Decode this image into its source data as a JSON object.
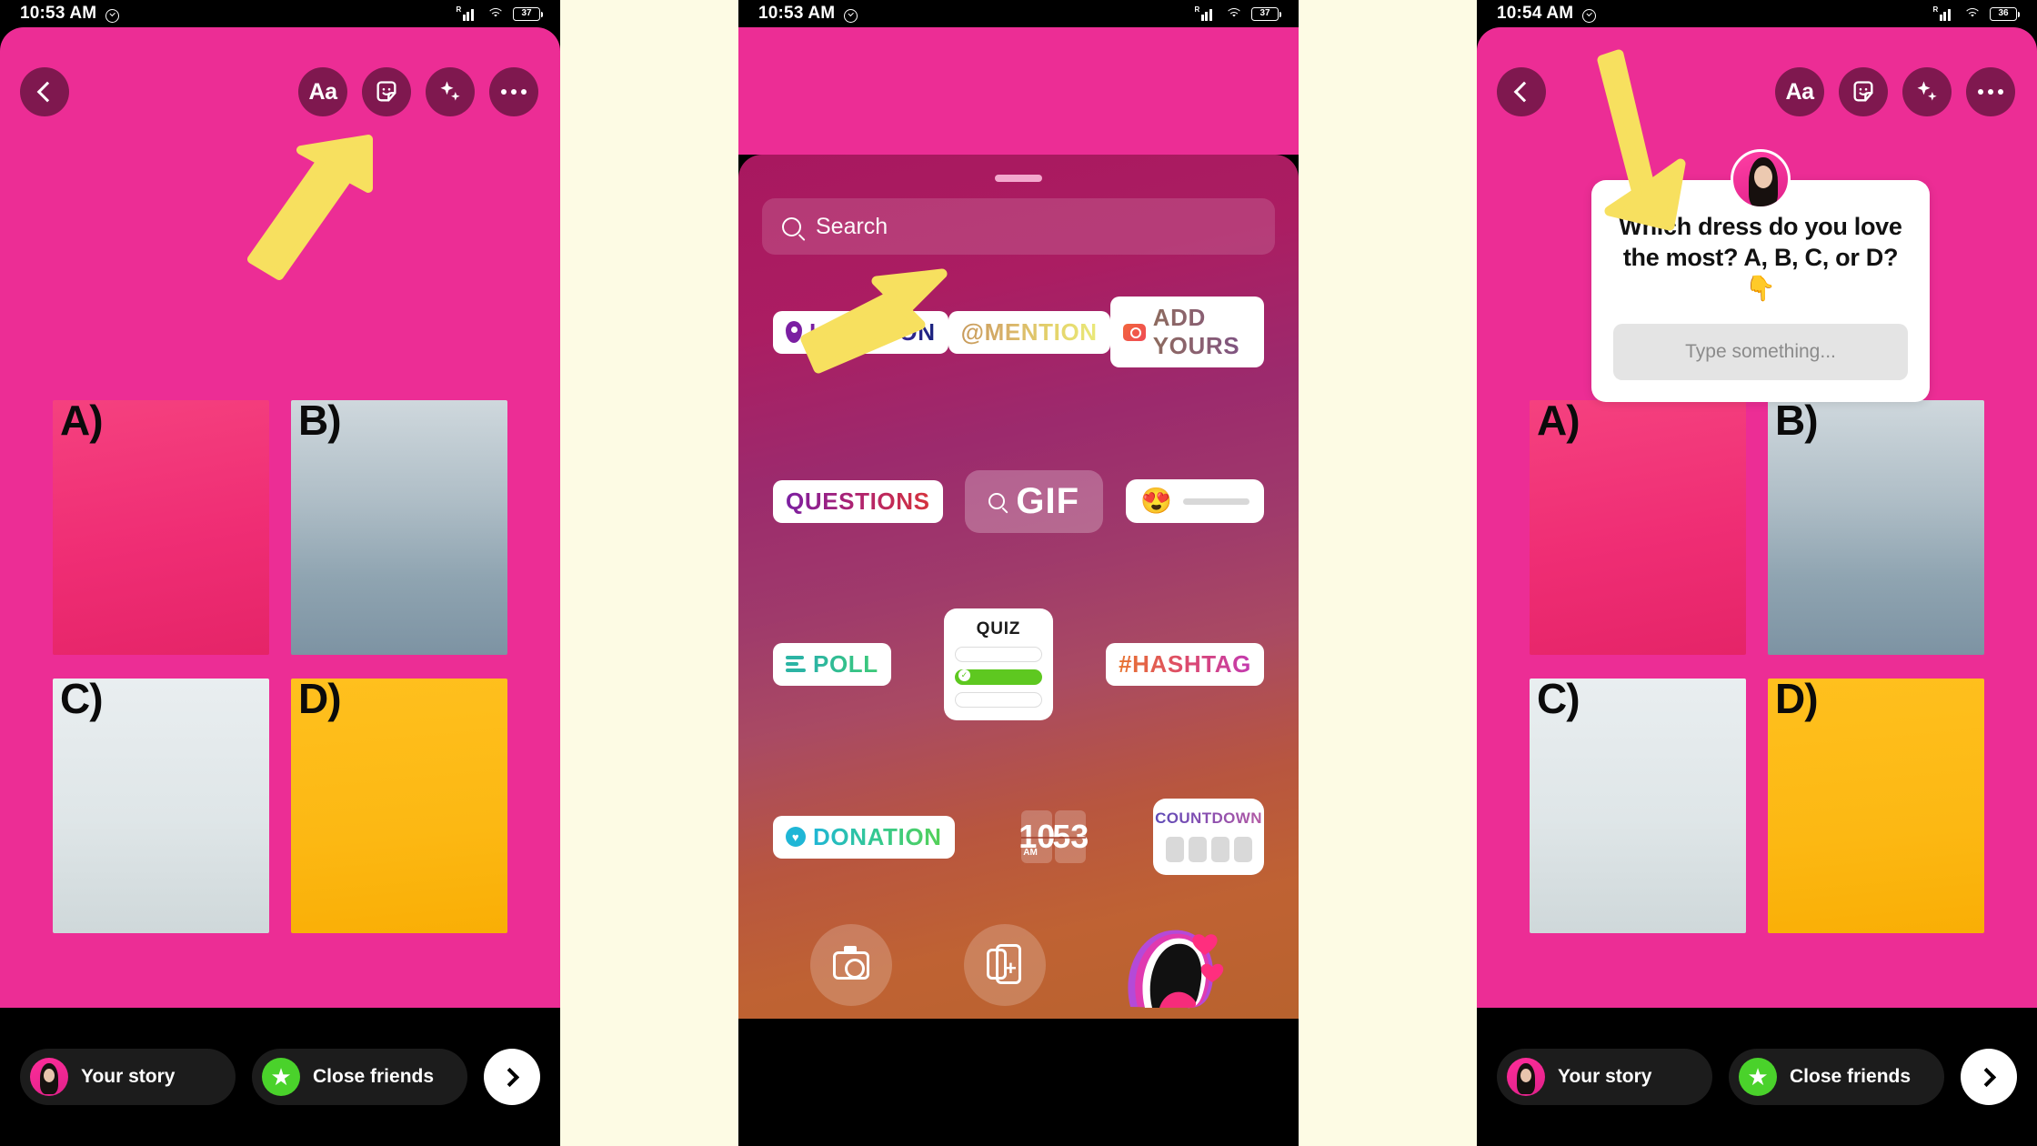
{
  "panels": [
    {
      "id": "panel-1",
      "status": {
        "time": "10:53 AM",
        "alarm_icon": "alarm-icon",
        "signal_icon": "signal-bars-icon",
        "roaming": "R",
        "wifi_icon": "wifi-icon",
        "battery": "37"
      },
      "toolbar": {
        "back": "back-icon",
        "text_tool": "Aa",
        "sticker_tool": "sticker-smiley-icon",
        "effects_tool": "sparkles-icon",
        "more_tool": "more-dots-icon"
      },
      "grid": [
        {
          "label": "A)",
          "name": "photo-option-a"
        },
        {
          "label": "B)",
          "name": "photo-option-b"
        },
        {
          "label": "C)",
          "name": "photo-option-c"
        },
        {
          "label": "D)",
          "name": "photo-option-d"
        }
      ],
      "share": {
        "your_story": "Your story",
        "close_friends": "Close friends",
        "next": "next-arrow-icon"
      },
      "annotation": "arrow pointing to sticker tool"
    },
    {
      "id": "panel-2",
      "status": {
        "time": "10:53 AM",
        "alarm_icon": "alarm-icon",
        "signal_icon": "signal-bars-icon",
        "roaming": "R",
        "wifi_icon": "wifi-icon",
        "battery": "37"
      },
      "tray": {
        "search_placeholder": "Search",
        "rows": [
          [
            {
              "label": "LOCATION",
              "icon": "location-pin-icon",
              "gradient": "g-location"
            },
            {
              "label": "@MENTION",
              "icon": "",
              "gradient": "g-mention"
            },
            {
              "label": "ADD YOURS",
              "icon": "camera-icon",
              "gradient": "g-addyours"
            }
          ],
          [
            {
              "label": "QUESTIONS",
              "icon": "",
              "gradient": "g-questions"
            },
            {
              "label": "GIF",
              "icon": "search-icon"
            },
            {
              "label": "",
              "icon": "emoji-slider",
              "emoji": "😍"
            }
          ],
          [
            {
              "label": "POLL",
              "icon": "poll-bars-icon",
              "gradient": "g-poll"
            },
            {
              "label": "QUIZ",
              "icon": "quiz-card"
            },
            {
              "label": "#HASHTAG",
              "icon": "",
              "gradient": "g-hashtag"
            }
          ],
          [
            {
              "label": "DONATION",
              "icon": "heart-circle-icon",
              "gradient": "g-donation"
            },
            {
              "label": "",
              "icon": "clock-sticker",
              "hour": "10",
              "minute": "53",
              "meridiem": "AM"
            },
            {
              "label": "COUNTDOWN",
              "icon": "countdown-card",
              "gradient": "g-countdown"
            }
          ]
        ],
        "bottom": {
          "camera": "camera-sticker-icon",
          "multi": "multi-capture-icon",
          "avatar": "avatar-sticker-icon"
        }
      },
      "annotation": "arrow pointing to QUESTIONS sticker"
    },
    {
      "id": "panel-3",
      "status": {
        "time": "10:54 AM",
        "alarm_icon": "alarm-icon",
        "signal_icon": "signal-bars-icon",
        "roaming": "R",
        "wifi_icon": "wifi-icon",
        "battery": "36"
      },
      "toolbar": {
        "back": "back-icon",
        "text_tool": "Aa",
        "sticker_tool": "sticker-smiley-icon",
        "effects_tool": "sparkles-icon",
        "more_tool": "more-dots-icon"
      },
      "question_sticker": {
        "avatar": "profile-avatar",
        "question": "Which dress do you love the most? A, B, C, or D? 👇",
        "answer_placeholder": "Type something..."
      },
      "grid": [
        {
          "label": "A)",
          "name": "photo-option-a"
        },
        {
          "label": "B)",
          "name": "photo-option-b"
        },
        {
          "label": "C)",
          "name": "photo-option-c"
        },
        {
          "label": "D)",
          "name": "photo-option-d"
        }
      ],
      "share": {
        "your_story": "Your story",
        "close_friends": "Close friends",
        "next": "next-arrow-icon"
      },
      "annotation": "arrow pointing to question sticker"
    }
  ],
  "colors": {
    "story_background": "#ec2d95",
    "page_background": "#fdfbe4",
    "arrow": "#f7e05f",
    "close_friends_green": "#4ad22b",
    "quiz_green": "#5ec820"
  }
}
